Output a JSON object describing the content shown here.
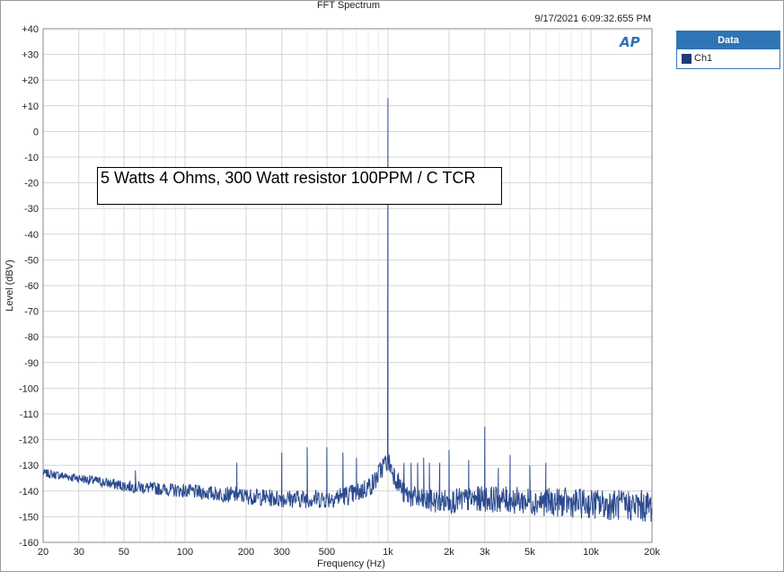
{
  "title": "FFT Spectrum",
  "timestamp": "9/17/2021 6:09:32.655 PM",
  "logo_text": "AP",
  "legend": {
    "header": "Data",
    "items": [
      {
        "label": "Ch1",
        "color": "#1f3a7a"
      }
    ]
  },
  "annotation": "5 Watts 4 Ohms, 300 Watt resistor 100PPM / C TCR",
  "chart_data": {
    "type": "line",
    "title": "FFT Spectrum",
    "xlabel": "Frequency (Hz)",
    "ylabel": "Level (dBV)",
    "xscale": "log",
    "xlim": [
      20,
      20000
    ],
    "ylim": [
      -160,
      40
    ],
    "grid": true,
    "x_ticks": [
      20,
      30,
      50,
      100,
      200,
      300,
      500,
      1000,
      2000,
      3000,
      5000,
      10000,
      20000
    ],
    "x_tick_labels": [
      "20",
      "30",
      "50",
      "100",
      "200",
      "300",
      "500",
      "1k",
      "2k",
      "3k",
      "5k",
      "10k",
      "20k"
    ],
    "y_ticks": [
      40,
      30,
      20,
      10,
      0,
      -10,
      -20,
      -30,
      -40,
      -50,
      -60,
      -70,
      -80,
      -90,
      -100,
      -110,
      -120,
      -130,
      -140,
      -150,
      -160
    ],
    "y_tick_labels": [
      "+40",
      "+30",
      "+20",
      "+10",
      "0",
      "-10",
      "-20",
      "-30",
      "-40",
      "-50",
      "-60",
      "-70",
      "-80",
      "-90",
      "-100",
      "-110",
      "-120",
      "-130",
      "-140",
      "-150",
      "-160"
    ],
    "series": [
      {
        "name": "Ch1",
        "color": "#2b4a8f",
        "floor": [
          [
            20,
            -133
          ],
          [
            30,
            -135
          ],
          [
            50,
            -138
          ],
          [
            100,
            -140
          ],
          [
            200,
            -142
          ],
          [
            300,
            -143
          ],
          [
            500,
            -143
          ],
          [
            700,
            -141
          ],
          [
            850,
            -137
          ],
          [
            950,
            -130
          ],
          [
            1000,
            -128
          ],
          [
            1050,
            -132
          ],
          [
            1200,
            -141
          ],
          [
            1500,
            -144
          ],
          [
            2000,
            -144
          ],
          [
            3000,
            -143
          ],
          [
            5000,
            -144
          ],
          [
            10000,
            -145
          ],
          [
            20000,
            -146
          ]
        ],
        "peaks": [
          [
            1000,
            13
          ],
          [
            3000,
            -115
          ],
          [
            180,
            -129
          ],
          [
            300,
            -125
          ],
          [
            400,
            -123
          ],
          [
            500,
            -123
          ],
          [
            600,
            -125
          ],
          [
            700,
            -127
          ],
          [
            2000,
            -124
          ],
          [
            4000,
            -126
          ],
          [
            6000,
            -129
          ],
          [
            1500,
            -127
          ],
          [
            2500,
            -128
          ],
          [
            3500,
            -131
          ],
          [
            5000,
            -130
          ],
          [
            57,
            -132
          ],
          [
            1200,
            -129
          ],
          [
            1300,
            -129
          ],
          [
            1400,
            -129
          ],
          [
            1600,
            -129
          ],
          [
            1800,
            -129
          ]
        ]
      }
    ]
  }
}
